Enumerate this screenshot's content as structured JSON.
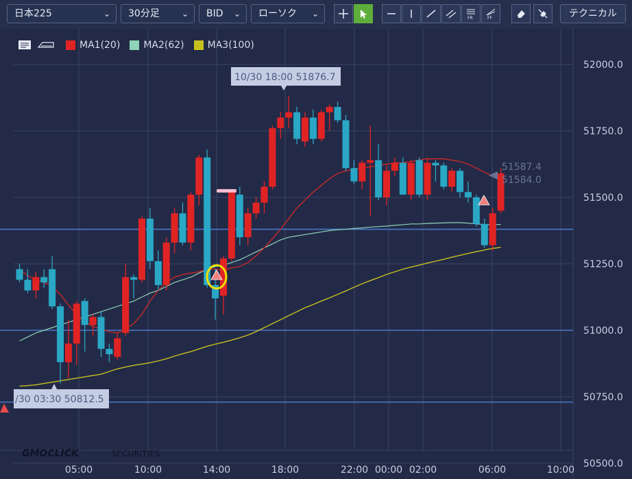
{
  "toolbar": {
    "symbol": "日本225",
    "timeframe": "30分足",
    "price_type": "BID",
    "chart_style": "ローソク",
    "technical_label": "テクニカル"
  },
  "legend": [
    {
      "label": "MA1(20)",
      "color": "#e02424"
    },
    {
      "label": "MA2(62)",
      "color": "#8fd4b8"
    },
    {
      "label": "MA3(100)",
      "color": "#c8c020"
    }
  ],
  "icons": [
    "comment-icon",
    "label-toggle-icon",
    "crosshair-icon",
    "cursor-icon",
    "horizontal-line-icon",
    "vertical-line-icon",
    "trend-line-icon",
    "channel-icon",
    "fibonacci-retracement-icon",
    "fibonacci-fan-icon",
    "eraser-icon",
    "erase-all-icon"
  ],
  "colors": {
    "up": "#e02424",
    "down": "#2aa7c5",
    "background": "#232a47",
    "grid": "#3a4466",
    "hline": "#4a78c8"
  },
  "watermark": {
    "brand": "GMOCLICK",
    "suffix": "SECURITIES"
  },
  "chart_data": {
    "type": "candlestick",
    "y_range": [
      50500,
      52100
    ],
    "y_ticks": [
      "52000.0",
      "51750.0",
      "51500.0",
      "51250.0",
      "51000.0",
      "50750.0",
      "50500.0"
    ],
    "x_ticks": [
      "05:00",
      "10:00",
      "14:00",
      "18:00",
      "22:00",
      "00:00",
      "02:00",
      "06:00",
      "10:00"
    ],
    "high_annotation": "10/30 18:00 51876.7",
    "low_annotation": "/30 03:30 50812.5",
    "last_price_1": "51587.4",
    "last_price_2": "51584.0",
    "horizontal_lines": [
      51380,
      51000,
      50730
    ],
    "candles": [
      [
        51230,
        51250,
        51180,
        51190
      ],
      [
        51190,
        51230,
        51140,
        51150
      ],
      [
        51150,
        51220,
        51120,
        51200
      ],
      [
        51200,
        51230,
        51160,
        51180
      ],
      [
        51230,
        51280,
        51080,
        51090
      ],
      [
        51090,
        51100,
        50800,
        50880
      ],
      [
        50880,
        51040,
        50820,
        50950
      ],
      [
        50950,
        51110,
        50870,
        51100
      ],
      [
        51110,
        51120,
        50920,
        51020
      ],
      [
        51020,
        51060,
        50980,
        51050
      ],
      [
        51050,
        51070,
        50900,
        50930
      ],
      [
        50930,
        50950,
        50880,
        50910
      ],
      [
        50900,
        50990,
        50890,
        50970
      ],
      [
        50990,
        51250,
        50980,
        51200
      ],
      [
        51200,
        51210,
        51120,
        51190
      ],
      [
        51190,
        51430,
        51180,
        51420
      ],
      [
        51420,
        51460,
        51230,
        51260
      ],
      [
        51260,
        51300,
        51150,
        51170
      ],
      [
        51170,
        51350,
        51150,
        51330
      ],
      [
        51330,
        51460,
        51290,
        51440
      ],
      [
        51440,
        51480,
        51320,
        51330
      ],
      [
        51330,
        51520,
        51300,
        51510
      ],
      [
        51510,
        51660,
        51470,
        51650
      ],
      [
        51650,
        51680,
        51160,
        51170
      ],
      [
        51170,
        51230,
        51040,
        51120
      ],
      [
        51130,
        51280,
        51060,
        51270
      ],
      [
        51270,
        51530,
        51260,
        51520
      ],
      [
        51510,
        51540,
        51320,
        51350
      ],
      [
        51350,
        51460,
        51320,
        51440
      ],
      [
        51440,
        51500,
        51420,
        51480
      ],
      [
        51480,
        51560,
        51440,
        51540
      ],
      [
        51540,
        51770,
        51530,
        51760
      ],
      [
        51760,
        51820,
        51720,
        51800
      ],
      [
        51800,
        51880,
        51760,
        51820
      ],
      [
        51820,
        51840,
        51700,
        51720
      ],
      [
        51710,
        51820,
        51690,
        51800
      ],
      [
        51800,
        51830,
        51700,
        51720
      ],
      [
        51720,
        51830,
        51710,
        51820
      ],
      [
        51820,
        51850,
        51750,
        51840
      ],
      [
        51840,
        51860,
        51780,
        51790
      ],
      [
        51790,
        51810,
        51600,
        51610
      ],
      [
        51610,
        51640,
        51550,
        51560
      ],
      [
        51560,
        51640,
        51530,
        51630
      ],
      [
        51630,
        51770,
        51430,
        51640
      ],
      [
        51640,
        51700,
        51490,
        51500
      ],
      [
        51500,
        51620,
        51470,
        51600
      ],
      [
        51600,
        51650,
        51580,
        51630
      ],
      [
        51630,
        51650,
        51510,
        51510
      ],
      [
        51510,
        51640,
        51490,
        51630
      ],
      [
        51640,
        51650,
        51500,
        51510
      ],
      [
        51510,
        51650,
        51490,
        51630
      ],
      [
        51630,
        51640,
        51560,
        51620
      ],
      [
        51620,
        51630,
        51530,
        51540
      ],
      [
        51540,
        51610,
        51520,
        51600
      ],
      [
        51600,
        51610,
        51500,
        51520
      ],
      [
        51520,
        51560,
        51480,
        51500
      ],
      [
        51500,
        51510,
        51390,
        51400
      ],
      [
        51400,
        51420,
        51310,
        51320
      ],
      [
        51320,
        51460,
        51300,
        51440
      ],
      [
        51450,
        51610,
        51440,
        51590
      ]
    ],
    "ma1": [
      51230,
      51205,
      51190,
      51180,
      51165,
      51135,
      51095,
      51060,
      51030,
      51015,
      51005,
      50995,
      50990,
      51005,
      51025,
      51060,
      51110,
      51150,
      51180,
      51200,
      51210,
      51215,
      51220,
      51230,
      51230,
      51225,
      51235,
      51240,
      51255,
      51280,
      51310,
      51345,
      51380,
      51420,
      51460,
      51490,
      51520,
      51545,
      51570,
      51590,
      51600,
      51605,
      51610,
      51615,
      51620,
      51625,
      51630,
      51630,
      51635,
      51640,
      51645,
      51645,
      51645,
      51640,
      51635,
      51625,
      51610,
      51595,
      51580,
      51570
    ],
    "ma2": [
      50960,
      50975,
      50990,
      51000,
      51010,
      51020,
      51030,
      51040,
      51050,
      51060,
      51070,
      51080,
      51090,
      51100,
      51110,
      51125,
      51140,
      51150,
      51165,
      51180,
      51190,
      51200,
      51215,
      51230,
      51240,
      51245,
      51255,
      51265,
      51280,
      51295,
      51310,
      51325,
      51340,
      51350,
      51355,
      51360,
      51365,
      51370,
      51375,
      51378,
      51380,
      51383,
      51385,
      51388,
      51390,
      51392,
      51395,
      51397,
      51400,
      51400,
      51402,
      51403,
      51404,
      51405,
      51405,
      51403,
      51400,
      51398,
      51397,
      51398
    ],
    "ma3": [
      50790,
      50792,
      50795,
      50800,
      50805,
      50810,
      50815,
      50820,
      50825,
      50830,
      50835,
      50845,
      50855,
      50862,
      50868,
      50873,
      50878,
      50885,
      50893,
      50903,
      50912,
      50920,
      50930,
      50940,
      50948,
      50955,
      50963,
      50972,
      50982,
      50995,
      51010,
      51025,
      51040,
      51055,
      51070,
      51085,
      51097,
      51110,
      51122,
      51135,
      51148,
      51162,
      51175,
      51187,
      51198,
      51210,
      51220,
      51230,
      51238,
      51245,
      51253,
      51260,
      51267,
      51275,
      51282,
      51289,
      51296,
      51302,
      51308,
      51312
    ]
  }
}
